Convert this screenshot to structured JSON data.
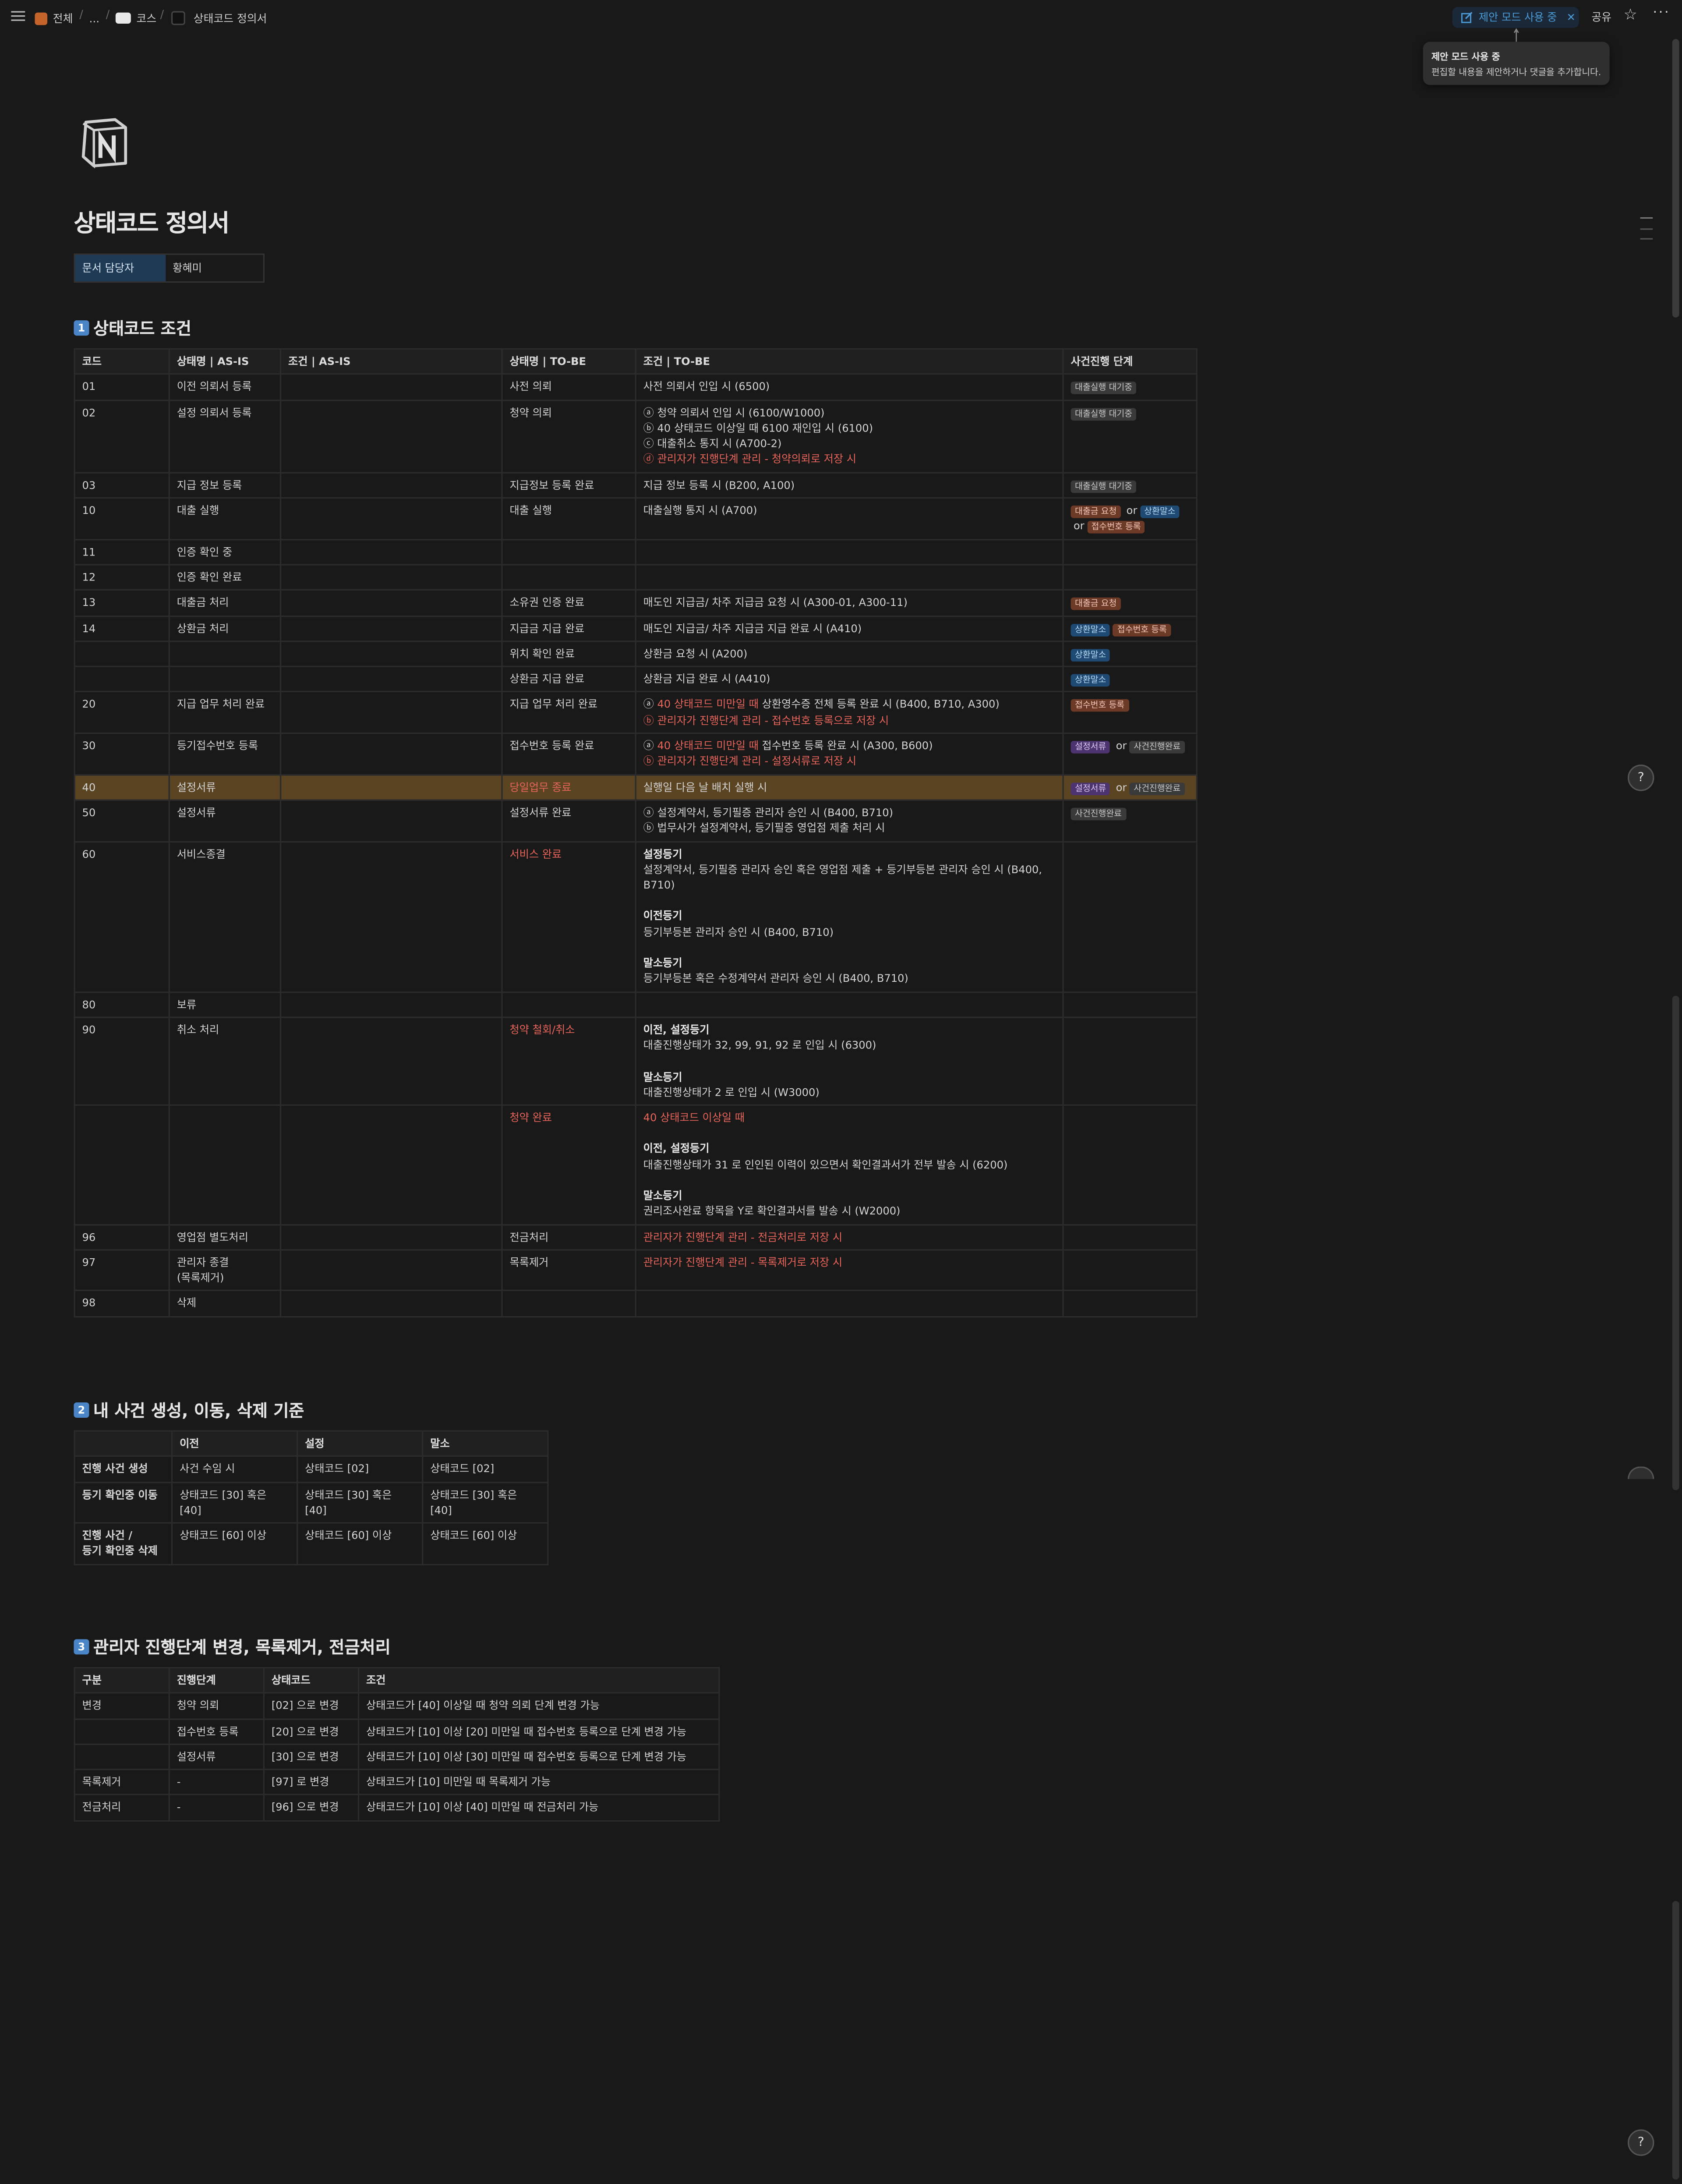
{
  "breadcrumb": {
    "item1": "전체",
    "ellipsis": "...",
    "item2": "코스",
    "item3": "상태코드 정의서"
  },
  "topbar": {
    "suggest_mode": "제안 모드 사용 중",
    "share": "공유"
  },
  "tooltip": {
    "title": "제안 모드 사용 중",
    "text": "편집할 내용을 제안하거나 댓글을 추가합니다."
  },
  "page": {
    "title": "상태코드 정의서",
    "property": {
      "key": "문서 담당자",
      "value": "황혜미"
    }
  },
  "section1": {
    "num": "1",
    "heading": "상태코드 조건",
    "headers": [
      "코드",
      "상태명 | AS-IS",
      "조건 | AS-IS",
      "상태명 | TO-BE",
      "조건 | TO-BE",
      "사건진행 단계"
    ],
    "rows": [
      {
        "code": "01",
        "as_name": "이전 의뢰서 등록",
        "as_cond": "",
        "to_name": "사전 의뢰",
        "to_cond": [
          "사전 의뢰서 인입 시 (6500)"
        ],
        "stage": [
          "대출실행 대기중"
        ]
      },
      {
        "code": "02",
        "as_name": "설정 의뢰서 등록",
        "as_cond": "",
        "to_name": "청약 의뢰",
        "to_cond": [
          "ⓐ 청약 의뢰서 인입 시 (6100/W1000)",
          "ⓑ 40 상태코드 이상일 때 6100 재인입 시 (6100)",
          "ⓒ 대출취소 통지 시 (A700-2)",
          "ⓓ 관리자가 진행단계 관리 - 청약의뢰로 저장 시"
        ],
        "stage": [
          "대출실행 대기중"
        ]
      },
      {
        "code": "03",
        "as_name": "지급 정보 등록",
        "as_cond": "",
        "to_name": "지급정보 등록 완료",
        "to_cond": [
          "지급 정보 등록 시 (B200, A100)"
        ],
        "stage": [
          "대출실행 대기중"
        ]
      },
      {
        "code": "10",
        "as_name": "대출 실행",
        "as_cond": "",
        "to_name": "대출 실행",
        "to_cond": [
          "대출실행 통지 시 (A700)"
        ],
        "stage": [
          "대출금 요청",
          "or",
          "상환말소",
          "or",
          "접수번호 등록"
        ]
      },
      {
        "code": "11",
        "as_name": "인증 확인 중",
        "as_cond": "",
        "to_name": "",
        "to_cond": [],
        "stage": []
      },
      {
        "code": "12",
        "as_name": "인증 확인 완료",
        "as_cond": "",
        "to_name": "",
        "to_cond": [],
        "stage": []
      },
      {
        "code": "13",
        "as_name": "대출금 처리",
        "as_cond": "",
        "to_name": "소유권 인증 완료",
        "to_cond": [
          "매도인 지급금/ 차주 지급금 요청 시 (A300-01, A300-11)"
        ],
        "stage": [
          "대출금 요청"
        ]
      },
      {
        "code": "14",
        "as_name": "상환금 처리",
        "as_cond": "",
        "to_name": "지급금 지급 완료",
        "to_cond": [
          "매도인 지급금/ 차주 지급금 지급 완료 시 (A410)"
        ],
        "stage": [
          "상환말소",
          "접수번호 등록"
        ]
      },
      {
        "code": "",
        "as_name": "",
        "as_cond": "",
        "to_name": "위치 확인 완료",
        "to_cond": [
          "상환금 요청 시 (A200)"
        ],
        "stage": [
          "상환말소"
        ]
      },
      {
        "code": "",
        "as_name": "",
        "as_cond": "",
        "to_name": "상환금 지급 완료",
        "to_cond": [
          "상환금 지급 완료 시 (A410)"
        ],
        "stage": [
          "상환말소"
        ]
      },
      {
        "code": "20",
        "as_name": "지급 업무 처리 완료",
        "as_cond": "",
        "to_name": "지급 업무 처리 완료",
        "to_cond": [
          "ⓐ 40 상태코드 미만일 때 상환영수증 전체 등록 완료 시 (B400, B710, A300)",
          "ⓑ 관리자가 진행단계 관리 - 접수번호 등록으로 저장 시"
        ],
        "stage": [
          "접수번호 등록"
        ]
      },
      {
        "code": "30",
        "as_name": "등기접수번호 등록",
        "as_cond": "",
        "to_name": "접수번호 등록 완료",
        "to_cond": [
          "ⓐ 40 상태코드 미만일 때 접수번호 등록 완료 시 (A300, B600)",
          "ⓑ 관리자가 진행단계 관리 - 설정서류로 저장 시"
        ],
        "stage": [
          "설정서류",
          "or",
          "사건진행완료"
        ]
      },
      {
        "code": "40",
        "as_name": "설정서류",
        "as_cond": "",
        "to_name": "당일업무 종료",
        "to_cond": [
          "실행일 다음 날 배치 실행 시"
        ],
        "stage": [
          "설정서류",
          "or",
          "사건진행완료"
        ]
      },
      {
        "code": "50",
        "as_name": "설정서류",
        "as_cond": "",
        "to_name": "설정서류 완료",
        "to_cond": [
          "ⓐ 설정계약서, 등기필증 관리자 승인 시 (B400, B710)",
          "ⓑ 법무사가 설정계약서, 등기필증 영업점 제출 처리 시"
        ],
        "stage": [
          "사건진행완료"
        ]
      },
      {
        "code": "60",
        "as_name": "서비스종결",
        "as_cond": "",
        "to_name": "서비스 완료",
        "to_cond": [
          "설정등기",
          "설정계약서, 등기필증 관리자 승인 혹은 영업점 제출 + 등기부등본 관리자 승인 시 (B400, B710)",
          "이전등기",
          "등기부등본 관리자 승인 시 (B400, B710)",
          "말소등기",
          "등기부등본 혹은 수정계약서 관리자 승인 시 (B400, B710)"
        ],
        "stage": []
      },
      {
        "code": "80",
        "as_name": "보류",
        "as_cond": "",
        "to_name": "",
        "to_cond": [],
        "stage": []
      },
      {
        "code": "90",
        "as_name": "취소 처리",
        "as_cond": "",
        "to_name": "청약 철회/취소",
        "to_cond": [
          "이전, 설정등기",
          "대출진행상태가 32, 99, 91, 92 로 인입 시 (6300)",
          "말소등기",
          "대출진행상태가 2 로 인입 시 (W3000)"
        ],
        "stage": []
      },
      {
        "code": "",
        "as_name": "",
        "as_cond": "",
        "to_name": "청약 완료",
        "to_cond": [
          "40 상태코드 이상일 때",
          "이전, 설정등기",
          "대출진행상태가 31 로 인인된 이력이 있으면서 확인결과서가 전부 발송 시 (6200)",
          "말소등기",
          "권리조사완료 항목을 Y로 확인결과서를 발송 시 (W2000)"
        ],
        "stage": []
      },
      {
        "code": "96",
        "as_name": "영업점 별도처리",
        "as_cond": "",
        "to_name": "전금처리",
        "to_cond": [
          "관리자가 진행단계 관리 - 전금처리로 저장 시"
        ],
        "stage": []
      },
      {
        "code": "97",
        "as_name": "관리자 종결(목록제거)",
        "as_cond": "",
        "to_name": "목록제거",
        "to_cond": [
          "관리자가 진행단계 관리 - 목록제거로 저장 시"
        ],
        "stage": []
      },
      {
        "code": "98",
        "as_name": "삭제",
        "as_cond": "",
        "to_name": "",
        "to_cond": [],
        "stage": []
      }
    ]
  },
  "section2": {
    "num": "2",
    "heading": "내 사건 생성, 이동, 삭제 기준",
    "headers": [
      "",
      "이전",
      "설정",
      "말소"
    ],
    "rows": [
      {
        "label": [
          "진행 사건 생성"
        ],
        "cells": [
          "사건 수임 시",
          "상태코드 [02]",
          "상태코드 [02]"
        ]
      },
      {
        "label": [
          "등기 확인중 이동"
        ],
        "cells": [
          "상태코드 [30] 혹은 [40]",
          "상태코드 [30] 혹은 [40]",
          "상태코드 [30] 혹은 [40]"
        ]
      },
      {
        "label": [
          "진행 사건 /",
          "등기 확인중 삭제"
        ],
        "cells": [
          "상태코드 [60] 이상",
          "상태코드 [60] 이상",
          "상태코드 [60] 이상"
        ]
      }
    ]
  },
  "section3": {
    "num": "3",
    "heading": "관리자 진행단계 변경, 목록제거, 전금처리",
    "headers": [
      "구분",
      "진행단계",
      "상태코드",
      "조건"
    ],
    "rows": [
      [
        "변경",
        "청약 의뢰",
        "[02] 으로 변경",
        "상태코드가 [40] 이상일 때 청약 의뢰 단계 변경 가능"
      ],
      [
        "",
        "접수번호 등록",
        "[20] 으로 변경",
        "상태코드가 [10] 이상 [20] 미만일 때 접수번호 등록으로 단계 변경 가능"
      ],
      [
        "",
        "설정서류",
        "[30] 으로 변경",
        "상태코드가 [10] 이상 [30] 미만일 때 접수번호 등록으로 단계 변경 가능"
      ],
      [
        "목록제거",
        "-",
        "[97] 로 변경",
        "상태코드가 [10] 미만일 때 목록제거 가능"
      ],
      [
        "전금처리",
        "-",
        "[96] 으로 변경",
        "상태코드가 [10] 이상 [40] 미만일 때 전금처리 가능"
      ]
    ]
  },
  "colors": {
    "background": "#191919",
    "accent_blue": "#4c9bd6",
    "highlight_row": "#5a4421",
    "red_text": "#e8655b"
  }
}
